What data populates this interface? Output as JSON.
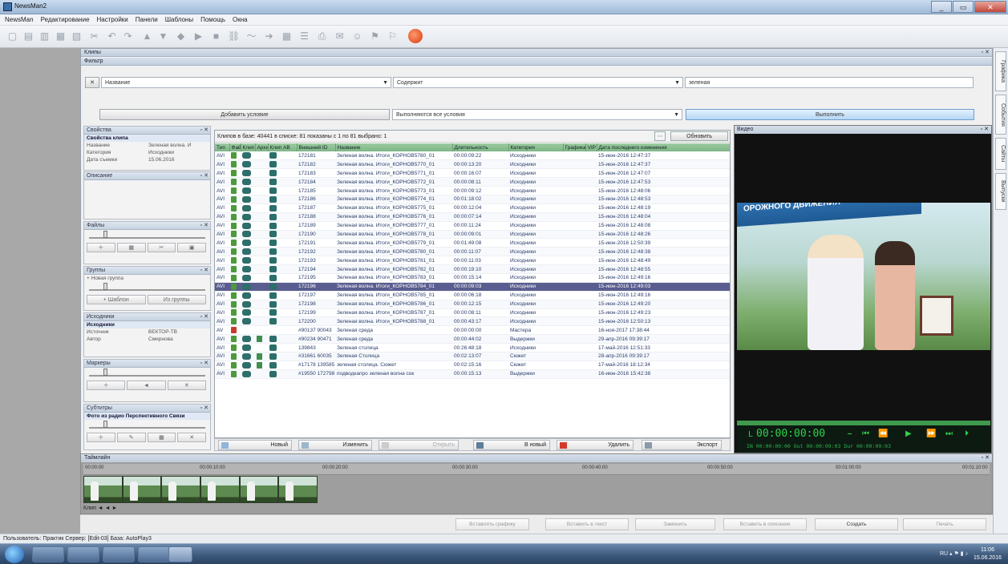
{
  "window": {
    "title": "NewsMan2"
  },
  "menu": [
    "NewsMan",
    "Редактирование",
    "Настройки",
    "Панели",
    "Шаблоны",
    "Помощь",
    "Окна"
  ],
  "panels": {
    "clips": "Клипы",
    "filter": "Фильтр",
    "video": "Видео",
    "timeline": "Таймлайн"
  },
  "filter": {
    "field": "Название",
    "operator": "Содержит",
    "value": "зеленая",
    "add_condition": "Добавить условие",
    "condition_mode": "Выполняются все условия",
    "execute": "Выполнить"
  },
  "side": {
    "props": {
      "title": "Свойства",
      "subtitle": "Свойства клипа",
      "rows": [
        [
          "Название",
          "Зеленая волна. И"
        ],
        [
          "Категория",
          "Исходники"
        ],
        [
          "Дата съемки",
          "15.06.2016"
        ]
      ]
    },
    "comment": {
      "title": "Описание"
    },
    "files": {
      "title": "Файлы"
    },
    "groups": {
      "title": "Группы",
      "row": "+ Новая группа",
      "btns": [
        "+ Шаблон",
        "Из группы"
      ]
    },
    "sources": {
      "title": "Исходники",
      "subtitle": "Исходники",
      "rows": [
        [
          "Источник",
          "ВЕКТОР-ТВ"
        ],
        [
          "Автор",
          "Смирнова"
        ]
      ]
    },
    "markers": {
      "title": "Маркеры"
    },
    "subs": {
      "title": "Субтитры",
      "row": "Фото из радио Перспективного Связи"
    }
  },
  "table": {
    "info": "Клипов в базе: 40441 в списке: 81  показаны с 1 по 81 выбрано: 1",
    "refresh": "Обновить",
    "headers": [
      "Тип",
      "Файлы",
      "Клип",
      "Архив",
      "Клип АВ",
      "Внешний ID",
      "Название",
      "Длительность",
      "Категория",
      "Графика",
      "VIP",
      "Дата последнего изменения"
    ],
    "rows": [
      {
        "t": "AVI",
        "f": "g",
        "c": 1,
        "a": 0,
        "l": 1,
        "id": "172181",
        "name": "Зеленая волна. Итоги_КОРНОВ5780_01",
        "dur": "00:00:09:22",
        "cat": "Исходники",
        "date": "15-июн-2016  12:47:37"
      },
      {
        "t": "AVI",
        "f": "g",
        "c": 1,
        "a": 0,
        "l": 1,
        "id": "172182",
        "name": "Зеленая волна. Итоги_КОРНОВ5770_01",
        "dur": "00:00:13:20",
        "cat": "Исходники",
        "date": "15-июн-2016  12:47:37"
      },
      {
        "t": "AVI",
        "f": "g",
        "c": 1,
        "a": 0,
        "l": 1,
        "id": "172183",
        "name": "Зеленая волна. Итоги_КОРНОВ5771_01",
        "dur": "00:00:16:07",
        "cat": "Исходники",
        "date": "15-июн-2016  12:47:07"
      },
      {
        "t": "AVI",
        "f": "g",
        "c": 1,
        "a": 0,
        "l": 1,
        "id": "172184",
        "name": "Зеленая волна. Итоги_КОРНОВ5772_01",
        "dur": "00:00:08:11",
        "cat": "Исходники",
        "date": "15-июн-2016  12:47:53"
      },
      {
        "t": "AVI",
        "f": "g",
        "c": 1,
        "a": 0,
        "l": 1,
        "id": "172185",
        "name": "Зеленая волна. Итоги_КОРНОВ5773_01",
        "dur": "00:00:09:12",
        "cat": "Исходники",
        "date": "15-июн-2016  12:48:06"
      },
      {
        "t": "AVI",
        "f": "g",
        "c": 1,
        "a": 0,
        "l": 1,
        "id": "172186",
        "name": "Зеленая волна. Итоги_КОРНОВ5774_01",
        "dur": "00:01:18:02",
        "cat": "Исходники",
        "date": "15-июн-2016  12:48:53"
      },
      {
        "t": "AVI",
        "f": "g",
        "c": 1,
        "a": 0,
        "l": 1,
        "id": "172187",
        "name": "Зеленая волна. Итоги_КОРНОВ5775_01",
        "dur": "00:00:12:04",
        "cat": "Исходники",
        "date": "15-июн-2016  12:48:19"
      },
      {
        "t": "AVI",
        "f": "g",
        "c": 1,
        "a": 0,
        "l": 1,
        "id": "172188",
        "name": "Зеленая волна. Итоги_КОРНОВ5776_01",
        "dur": "00:00:07:14",
        "cat": "Исходники",
        "date": "15-июн-2016  12:48:04"
      },
      {
        "t": "AVI",
        "f": "g",
        "c": 1,
        "a": 0,
        "l": 1,
        "id": "172189",
        "name": "Зеленая волна. Итоги_КОРНОВ5777_01",
        "dur": "00:00:11:24",
        "cat": "Исходники",
        "date": "15-июн-2016  12:48:08"
      },
      {
        "t": "AVI",
        "f": "g",
        "c": 1,
        "a": 0,
        "l": 1,
        "id": "172190",
        "name": "Зеленая волна. Итоги_КОРНОВ5778_01",
        "dur": "00:00:09:01",
        "cat": "Исходники",
        "date": "15-июн-2016  12:48:26"
      },
      {
        "t": "AVI",
        "f": "g",
        "c": 1,
        "a": 0,
        "l": 1,
        "id": "172191",
        "name": "Зеленая волна. Итоги_КОРНОВ5779_01",
        "dur": "00:01:49:08",
        "cat": "Исходники",
        "date": "15-июн-2016  12:50:39"
      },
      {
        "t": "AVI",
        "f": "g",
        "c": 1,
        "a": 0,
        "l": 1,
        "id": "172192",
        "name": "Зеленая волна. Итоги_КОРНОВ5780_01",
        "dur": "00:00:11:07",
        "cat": "Исходники",
        "date": "15-июн-2016  12:48:38"
      },
      {
        "t": "AVI",
        "f": "g",
        "c": 1,
        "a": 0,
        "l": 1,
        "id": "172193",
        "name": "Зеленая волна. Итоги_КОРНОВ5781_01",
        "dur": "00:00:11:03",
        "cat": "Исходники",
        "date": "15-июн-2016  12:48:49"
      },
      {
        "t": "AVI",
        "f": "g",
        "c": 1,
        "a": 0,
        "l": 1,
        "id": "172194",
        "name": "Зеленая волна. Итоги_КОРНОВ5782_01",
        "dur": "00:00:19:10",
        "cat": "Исходники",
        "date": "15-июн-2016  12:48:55"
      },
      {
        "t": "AVI",
        "f": "g",
        "c": 1,
        "a": 0,
        "l": 1,
        "id": "172195",
        "name": "Зеленая волна. Итоги_КОРНОВ5783_01",
        "dur": "00:00:15:14",
        "cat": "Исходники",
        "date": "15-июн-2016  12:49:16"
      },
      {
        "t": "AVI",
        "f": "g",
        "c": 1,
        "a": 0,
        "l": 1,
        "id": "172196",
        "name": "Зеленая волна. Итоги_КОРНОВ5784_01",
        "dur": "00:00:09:03",
        "cat": "Исходники",
        "date": "15-июн-2016  12:49:03",
        "sel": true
      },
      {
        "t": "AVI",
        "f": "g",
        "c": 1,
        "a": 0,
        "l": 1,
        "id": "172197",
        "name": "Зеленая волна. Итоги_КОРНОВ5785_01",
        "dur": "00:00:06:18",
        "cat": "Исходники",
        "date": "15-июн-2016  12:49:16"
      },
      {
        "t": "AVI",
        "f": "g",
        "c": 1,
        "a": 0,
        "l": 1,
        "id": "172198",
        "name": "Зеленая волна. Итоги_КОРНОВ5786_01",
        "dur": "00:00:12:15",
        "cat": "Исходники",
        "date": "15-июн-2016  12:49:20"
      },
      {
        "t": "AVI",
        "f": "g",
        "c": 1,
        "a": 0,
        "l": 1,
        "id": "172199",
        "name": "Зеленая волна. Итоги_КОРНОВ5787_01",
        "dur": "00:00:08:11",
        "cat": "Исходники",
        "date": "15-июн-2016  12:49:23"
      },
      {
        "t": "AVI",
        "f": "g",
        "c": 1,
        "a": 0,
        "l": 1,
        "id": "172200",
        "name": "Зеленая волна. Итоги_КОРНОВ5788_01",
        "dur": "00:00:43:17",
        "cat": "Исходники",
        "date": "15-июн-2016  12:50:13"
      },
      {
        "t": "AV",
        "f": "r",
        "c": 0,
        "a": 0,
        "l": 0,
        "id": "#90137 90043",
        "name": "Зеленая среда",
        "dur": "00:00:00:00",
        "cat": "Мастера",
        "date": "16-ноя-2017  17:38:44"
      },
      {
        "t": "AVI",
        "f": "g",
        "c": 1,
        "a": 1,
        "l": 1,
        "id": "#90234 90471",
        "name": "Зеленая среда",
        "dur": "00:00:44:02",
        "cat": "Выдержки",
        "date": "29-апр-2016  09:39:17"
      },
      {
        "t": "AVI",
        "f": "g",
        "c": 1,
        "a": 0,
        "l": 1,
        "id": "139843",
        "name": "Зеленая столица",
        "dur": "00:26:48:18",
        "cat": "Исходники",
        "date": "17-май-2016  12:51:33"
      },
      {
        "t": "AVI",
        "f": "g",
        "c": 1,
        "a": 1,
        "l": 1,
        "id": "#31661 60035",
        "name": "Зеленая Столица",
        "dur": "00:02:13:07",
        "cat": "Сюжет",
        "date": "28-апр-2016  09:39:17"
      },
      {
        "t": "AVI",
        "f": "g",
        "c": 1,
        "a": 1,
        "l": 1,
        "id": "#17178 139585",
        "name": "зеленая столица. Сюжет",
        "dur": "00:02:15:16",
        "cat": "Сюжет",
        "date": "17-май-2016  18:12:34"
      },
      {
        "t": "AVI",
        "f": "g",
        "c": 1,
        "a": 0,
        "l": 1,
        "id": "#19550 172798",
        "name": "подводкапро зеленая волна сок",
        "dur": "00:00:15:13",
        "cat": "Выдержки",
        "date": "16-июн-2016  15:42:38"
      }
    ]
  },
  "tbl_toolbar": {
    "new": "Новый",
    "edit": "Изменить",
    "open": "Открыть",
    "to_new": "В новый",
    "delete": "Удалить",
    "export": "Экспорт"
  },
  "video": {
    "banner": "ОРОЖНОГО ДВИЖЕНИЯ",
    "timecode": "00:00:00:00",
    "tc_row": "IN 00:00:00:00   Out 00:00:09:03   Dur 00:00:09:03"
  },
  "timeline": {
    "clip_label": "Клип",
    "ticks": [
      "00:00:00",
      "00:00:10:00",
      "00:00:20:00",
      "00:00:30:00",
      "00:00:40:00",
      "00:00:50:00",
      "00:01:00:00",
      "00:01:10:00"
    ],
    "footer": "Клип  ◄ ◄ ►"
  },
  "actions": [
    "Вставлять графику",
    "Вставить в текст",
    "Заменить",
    "Вставить в описание",
    "Создать",
    "Печать"
  ],
  "vtabs": [
    "Графика",
    "События",
    "Сайты",
    "Выпуски"
  ],
  "status": "Пользователь: Практик   Сервер: [Edit-03]   База: AutoPlay3",
  "clock": {
    "time": "11:06",
    "date": "15.06.2016"
  }
}
